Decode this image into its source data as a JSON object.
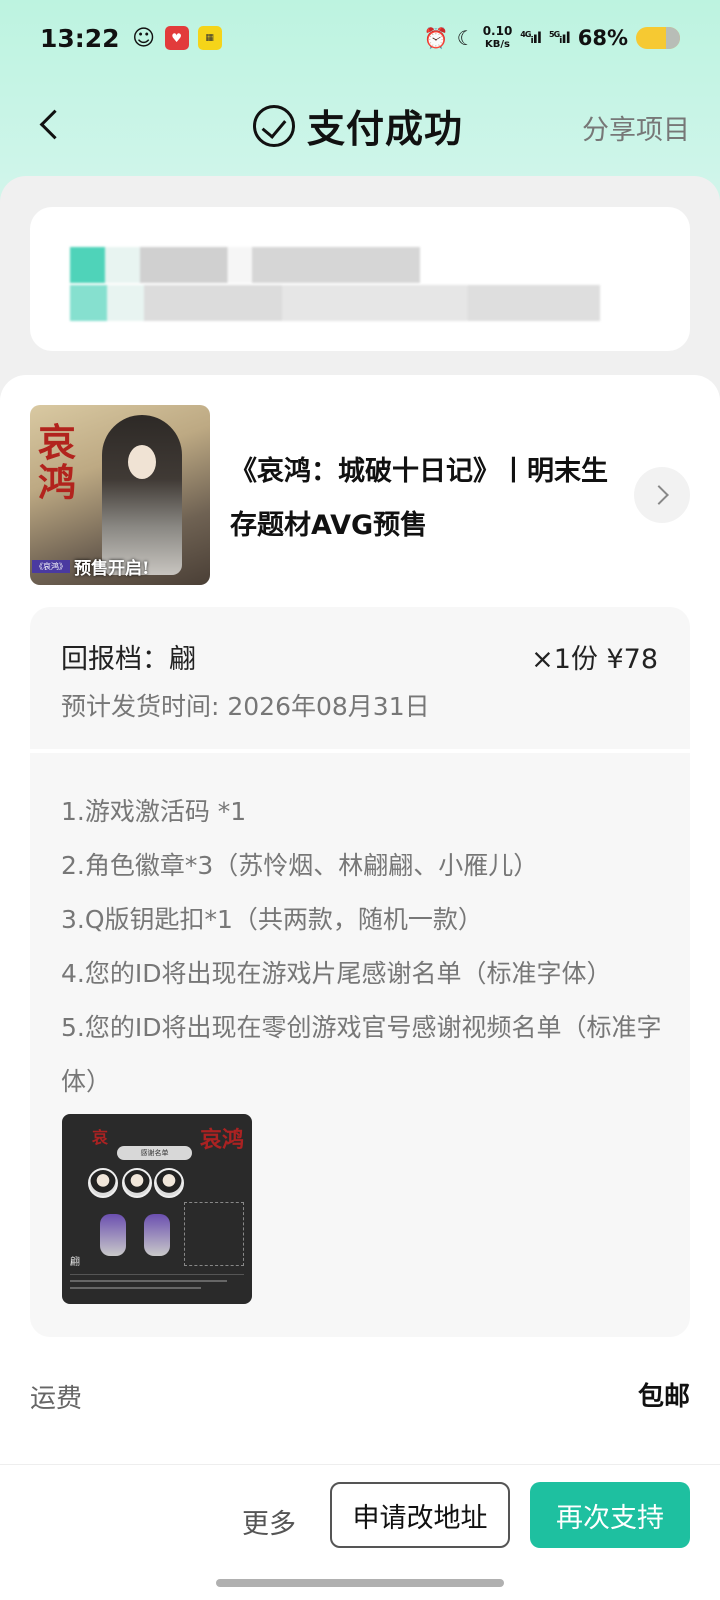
{
  "status_bar": {
    "time": "13:22",
    "net_speed": "0.10",
    "net_unit": "KB/s",
    "sim1": "4G",
    "sim2": "5G",
    "battery": "68%",
    "icons": [
      "wechat-icon",
      "red-app-icon",
      "yellow-app-icon",
      "alarm-icon",
      "moon-icon",
      "signal-icon",
      "signal-icon",
      "battery-icon"
    ]
  },
  "header": {
    "title": "支付成功",
    "share": "分享项目"
  },
  "project": {
    "title": "《哀鸿：城破十日记》丨明末生存题材AVG预售",
    "cover_title": "哀鸿",
    "cover_tag": "预售开启!"
  },
  "reward": {
    "name": "回报档：翩",
    "qty_price": "×1份  ¥78",
    "ship_date": "预计发货时间: 2026年08月31日",
    "items": [
      "1.游戏激活码 *1",
      "2.角色徽章*3（苏怜烟、林翩翩、小雁儿）",
      "3.Q版钥匙扣*1（共两款，随机一款）",
      "4.您的ID将出现在游戏片尾感谢名单（标准字体）",
      "5.您的ID将出现在零创游戏官号感谢视频名单（标准字体）"
    ],
    "thumb_banner": "感谢名单",
    "thumb_name": "翩"
  },
  "freight": {
    "label": "运费",
    "value": "包邮"
  },
  "actions": {
    "more": "更多",
    "change_address": "申请改地址",
    "support_again": "再次支持"
  },
  "colors": {
    "accent": "#1ec0a0",
    "header_bg": "#bdf3e0"
  }
}
